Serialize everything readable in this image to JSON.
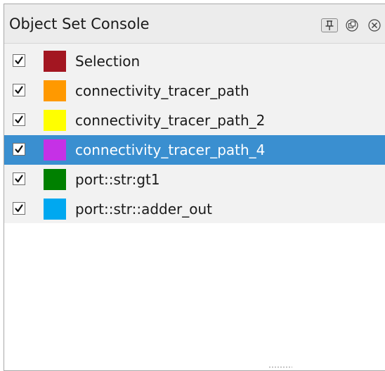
{
  "console": {
    "title": "Object Set Console",
    "buttons": [
      {
        "name": "pin-icon"
      },
      {
        "name": "float-icon"
      },
      {
        "name": "close-icon"
      }
    ]
  },
  "object_sets": [
    {
      "label": "Selection",
      "color": "#a31621",
      "checked": true,
      "selected": false
    },
    {
      "label": "connectivity_tracer_path",
      "color": "#ff9900",
      "checked": true,
      "selected": false
    },
    {
      "label": "connectivity_tracer_path_2",
      "color": "#ffff00",
      "checked": true,
      "selected": false
    },
    {
      "label": "connectivity_tracer_path_4",
      "color": "#c531e6",
      "checked": true,
      "selected": true
    },
    {
      "label": "port::str:gt1",
      "color": "#008000",
      "checked": true,
      "selected": false
    },
    {
      "label": "port::str::adder_out",
      "color": "#00a8f0",
      "checked": true,
      "selected": false
    }
  ]
}
